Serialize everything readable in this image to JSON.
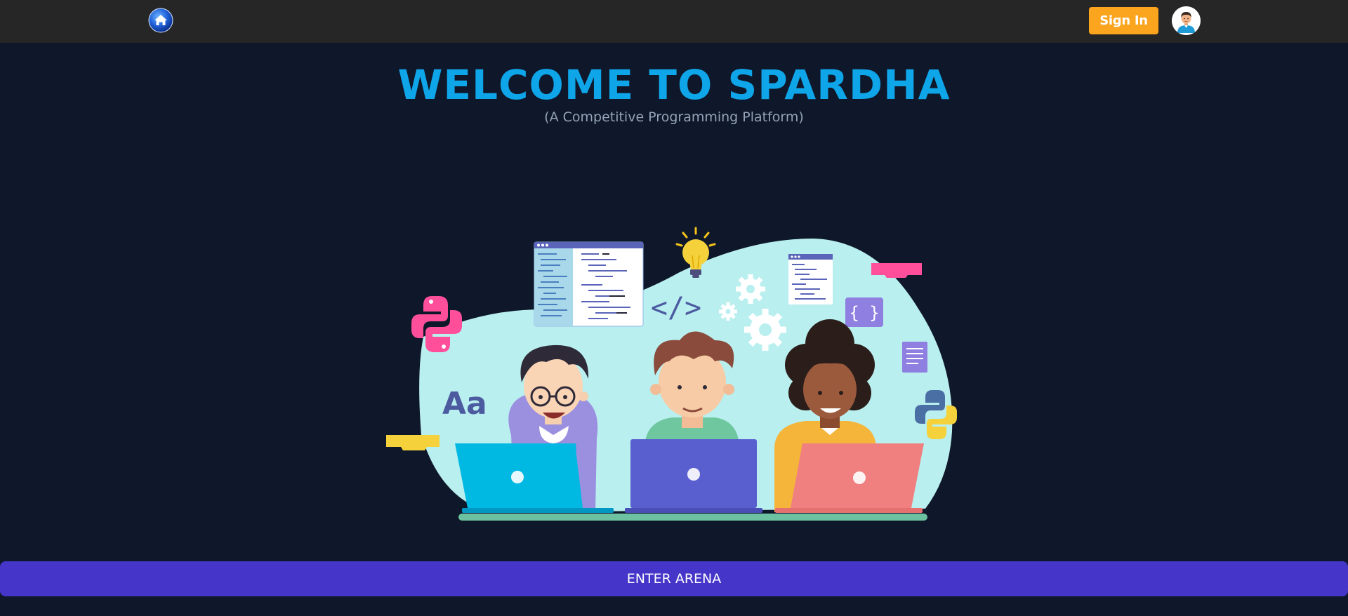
{
  "header": {
    "home_icon": "home-icon",
    "signin_label": "Sign In",
    "avatar_icon": "user-avatar-icon"
  },
  "hero": {
    "title": "WELCOME TO SPARDHA",
    "subtitle": "(A Competitive Programming Platform)"
  },
  "illustration": {
    "font_sample": "Aa",
    "code_symbol": "</>",
    "braces_symbol": "{ }"
  },
  "cta": {
    "label": "ENTER ARENA"
  },
  "colors": {
    "background": "#0f172a",
    "header": "#262626",
    "accent_title": "#0ea5e9",
    "signin": "#fba41d",
    "cta": "#4535c8"
  }
}
